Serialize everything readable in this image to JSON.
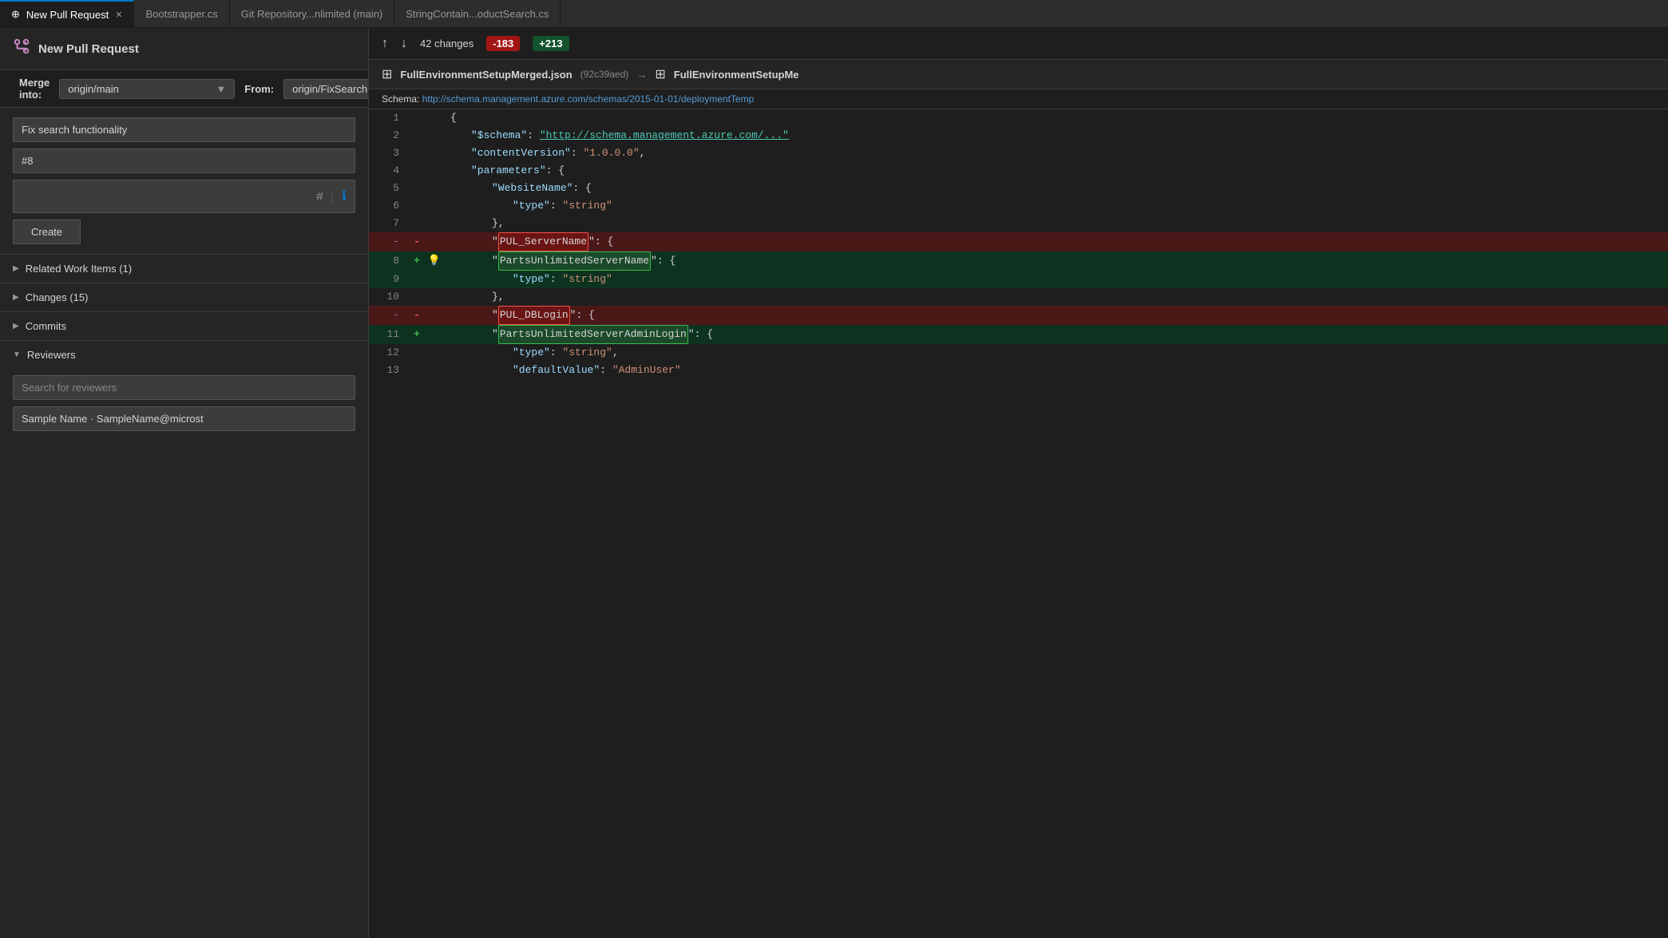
{
  "tabs": [
    {
      "id": "new-pr",
      "label": "New Pull Request",
      "active": true,
      "pinIcon": "⊕",
      "closeIcon": "✕"
    },
    {
      "id": "bootstrapper",
      "label": "Bootstrapper.cs",
      "active": false
    },
    {
      "id": "git-repo",
      "label": "Git Repository...nlimited (main)",
      "active": false
    },
    {
      "id": "string-contain",
      "label": "StringContain...oductSearch.cs",
      "active": false
    }
  ],
  "header": {
    "icon": "⚙",
    "title": "New Pull Request",
    "mergeIntoLabel": "Merge into:",
    "mergeIntoBranch": "origin/main",
    "fromLabel": "From:",
    "fromBranch": "origin/FixSearchFunctionality"
  },
  "form": {
    "titleValue": "Fix search functionality",
    "idValue": "#8",
    "descriptionPlaceholder": "",
    "hashIcon": "#",
    "infoIcon": "ℹ",
    "createLabel": "Create"
  },
  "sections": [
    {
      "id": "related-work-items",
      "label": "Related Work Items (1)",
      "expanded": false,
      "arrow": "▶"
    },
    {
      "id": "changes",
      "label": "Changes (15)",
      "expanded": false,
      "arrow": "▶"
    },
    {
      "id": "commits",
      "label": "Commits",
      "expanded": false,
      "arrow": "▶"
    },
    {
      "id": "reviewers",
      "label": "Reviewers",
      "expanded": true,
      "arrow": "▼"
    }
  ],
  "reviewers": {
    "searchPlaceholder": "Search for reviewers",
    "reviewerName": "Sample Name · SampleName@microst"
  },
  "changes": {
    "upArrow": "↑",
    "downArrow": "↓",
    "changesText": "42 changes",
    "removedBadge": "-183",
    "addedBadge": "+213"
  },
  "fileHeader": {
    "iconLeft": "{}",
    "fileName": "FullEnvironmentSetupMerged.json",
    "hash": "(92c39aed)",
    "arrow": "→",
    "iconRight": "{}",
    "fileNameRight": "FullEnvironmentSetupMe"
  },
  "schema": {
    "label": "Schema:",
    "url": "http://schema.management.azure.com/schemas/2015-01-01/deploymentTemp"
  },
  "codeLines": [
    {
      "num": "1",
      "sign": "",
      "type": "normal",
      "content": "{",
      "icon": ""
    },
    {
      "num": "2",
      "sign": "",
      "type": "normal",
      "content": "    \"$schema\":  \"http://schema.management.azure.com/...\"",
      "icon": ""
    },
    {
      "num": "3",
      "sign": "",
      "type": "normal",
      "content": "    \"contentVersion\": \"1.0.0.0\",",
      "icon": ""
    },
    {
      "num": "4",
      "sign": "",
      "type": "normal",
      "content": "    \"parameters\": {",
      "icon": ""
    },
    {
      "num": "5",
      "sign": "",
      "type": "normal",
      "content": "        \"WebsiteName\": {",
      "icon": ""
    },
    {
      "num": "6",
      "sign": "",
      "type": "normal",
      "content": "            \"type\": \"string\"",
      "icon": ""
    },
    {
      "num": "7",
      "sign": "",
      "type": "normal",
      "content": "        },",
      "icon": ""
    },
    {
      "num": "-",
      "sign": "-",
      "type": "removed",
      "content": "        \"PUL_ServerName\": {",
      "icon": "",
      "highlight": "PUL_ServerName"
    },
    {
      "num": "8",
      "sign": "+",
      "type": "added",
      "content": "        \"PartsUnlimitedServerName\": {",
      "icon": "💡",
      "highlight": "PartsUnlimitedServerName"
    },
    {
      "num": "9",
      "sign": "",
      "type": "added",
      "content": "            \"type\": \"string\"",
      "icon": ""
    },
    {
      "num": "10",
      "sign": "",
      "type": "normal",
      "content": "        },",
      "icon": ""
    },
    {
      "num": "-",
      "sign": "-",
      "type": "removed",
      "content": "        \"PUL_DBLogin\": {",
      "icon": "",
      "highlight": "PUL_DBLogin"
    },
    {
      "num": "11",
      "sign": "+",
      "type": "added",
      "content": "        \"PartsUnlimitedServerAdminLogin\": {",
      "icon": "",
      "highlight": "PartsUnlimitedServerAdminLogin"
    },
    {
      "num": "12",
      "sign": "",
      "type": "normal",
      "content": "            \"type\": \"string\",",
      "icon": ""
    },
    {
      "num": "13",
      "sign": "",
      "type": "normal",
      "content": "            \"defaultValue\": \"AdminUser\"",
      "icon": ""
    }
  ]
}
